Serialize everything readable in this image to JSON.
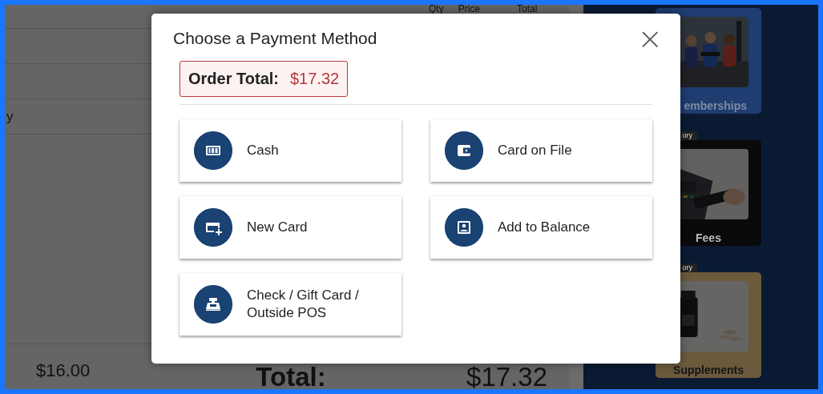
{
  "background": {
    "columns": [
      "Qty",
      "Price",
      "Total"
    ],
    "rows": [
      {
        "text": ""
      },
      {
        "text": ""
      },
      {
        "text": "y"
      }
    ],
    "subtotal": "$16.00",
    "total_label": "Total:",
    "total_value": "$17.32",
    "categories": [
      {
        "name": "emberships",
        "color": "#1f3d70",
        "kind": "people"
      },
      {
        "tag": "ory",
        "name": "Fees",
        "color": "#0a0a0a",
        "kind": "terminal"
      },
      {
        "tag": "ory",
        "name": "Supplements",
        "color": "#6b5a3c",
        "kind": "bottle"
      }
    ]
  },
  "dialog": {
    "title": "Choose a Payment Method",
    "close": "×",
    "order_total_label": "Order Total:",
    "order_total_value": "$17.32",
    "methods": [
      {
        "label": "Cash",
        "kind": "cash"
      },
      {
        "label": "Card on File",
        "kind": "wallet"
      },
      {
        "label": "New Card",
        "kind": "card-plus"
      },
      {
        "label": "Add to Balance",
        "kind": "account"
      },
      {
        "label": "Check / Gift Card / Outside POS",
        "kind": "register"
      }
    ]
  }
}
